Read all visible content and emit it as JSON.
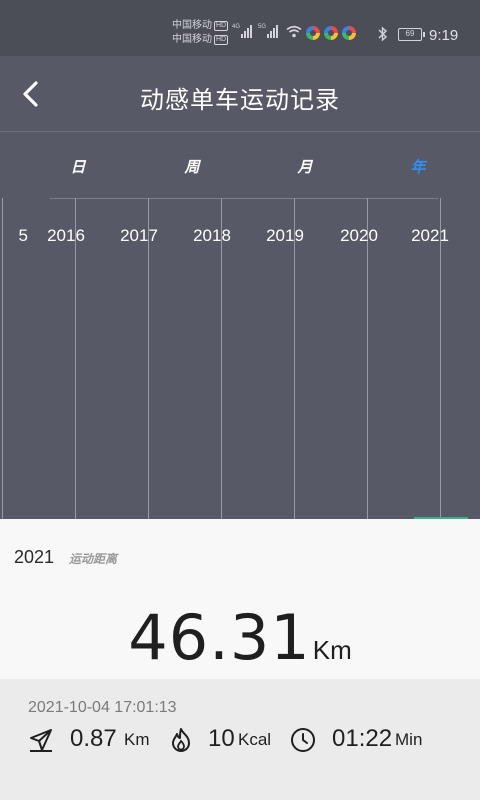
{
  "status_bar": {
    "carrier1": "中国移动",
    "carrier2": "中国移动",
    "hd": "HD",
    "sig1_gen": "4G",
    "sig2_gen": "5G",
    "battery": "69",
    "time": "9:19"
  },
  "header": {
    "back_icon": "chevron-left-icon",
    "title": "动感单车运动记录"
  },
  "tabs": [
    {
      "label": "日",
      "active": false
    },
    {
      "label": "周",
      "active": false
    },
    {
      "label": "月",
      "active": false
    },
    {
      "label": "年",
      "active": true
    }
  ],
  "accent_color": "#2f8ff0",
  "chart": {
    "years": [
      "5",
      "2016",
      "2017",
      "2018",
      "2019",
      "2020",
      "2021"
    ]
  },
  "summary": {
    "year": "2021",
    "metric_label": "运动距离",
    "distance": "46.31",
    "distance_unit": "Km"
  },
  "record": {
    "datetime": "2021-10-04 17:01:13",
    "distance": "0.87",
    "distance_unit": "Km",
    "calories": "10",
    "calories_unit": "Kcal",
    "duration": "01:22",
    "duration_unit": "Min"
  }
}
